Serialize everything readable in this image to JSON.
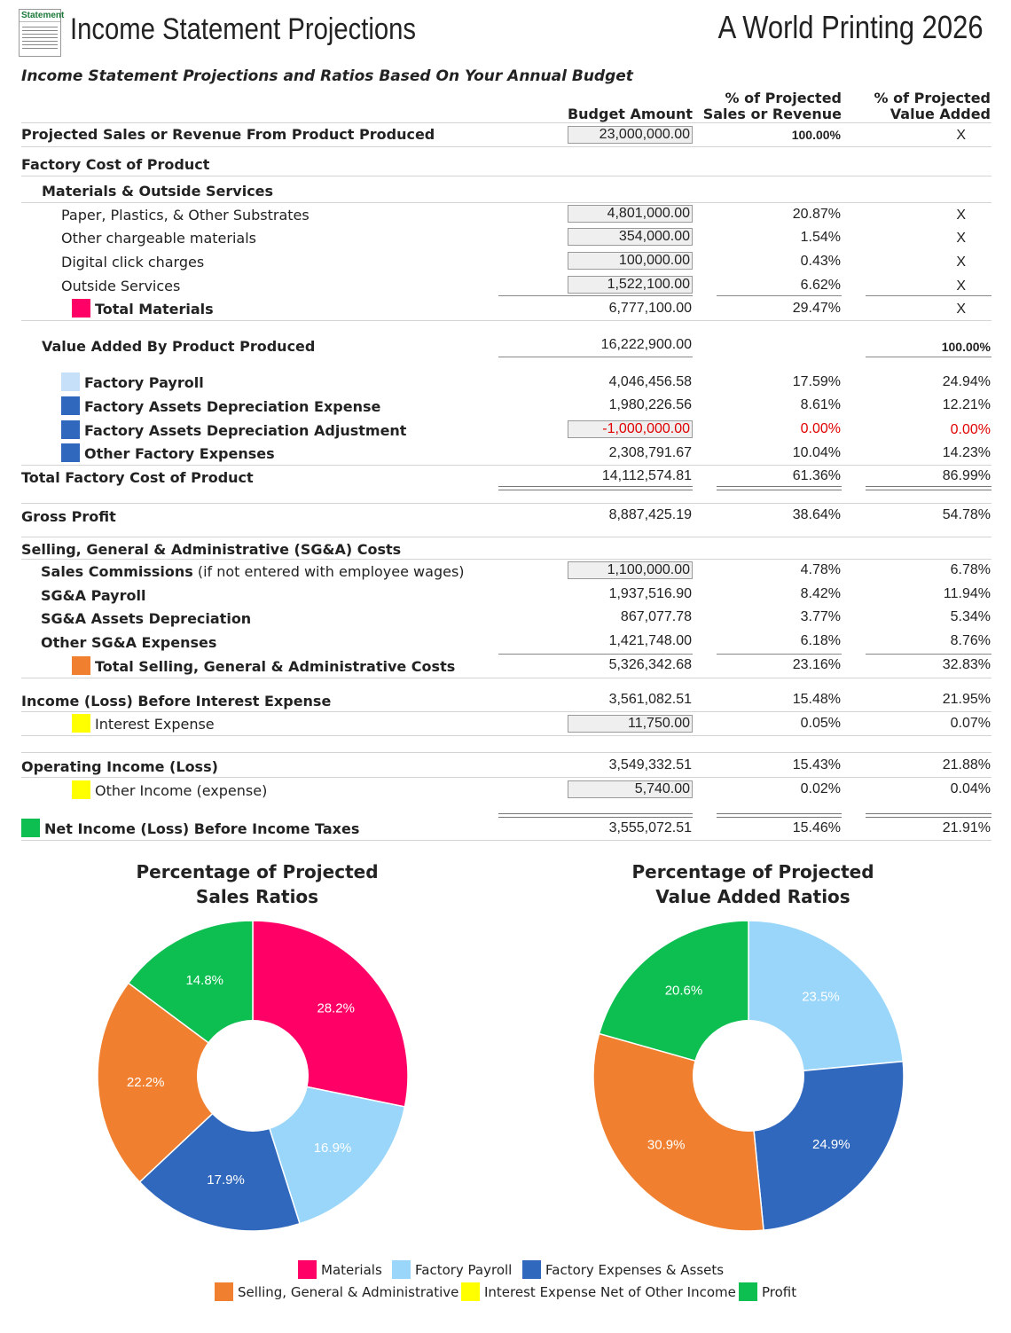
{
  "header": {
    "logo_text": "Statement",
    "title": "Income Statement Projections",
    "company": "A World Printing 2026",
    "subtitle": "Income Statement Projections and Ratios Based On Your Annual Budget"
  },
  "columns": {
    "budget": "Budget Amount",
    "sales_1": "% of Projected",
    "sales_2": "Sales or Revenue",
    "va_1": "% of Projected",
    "va_2": "Value Added"
  },
  "rows": {
    "sales": {
      "label": "Projected Sales or Revenue From Product Produced",
      "amount": "23,000,000.00",
      "pct_sales": "100.00%",
      "pct_va": "X"
    },
    "factory_cost": {
      "label": "Factory Cost of Product"
    },
    "materials_services": {
      "label": "Materials & Outside Services"
    },
    "paper": {
      "label": "Paper, Plastics, & Other Substrates",
      "amount": "4,801,000.00",
      "pct_sales": "20.87%",
      "pct_va": "X"
    },
    "other_materials": {
      "label": "Other chargeable materials",
      "amount": "354,000.00",
      "pct_sales": "1.54%",
      "pct_va": "X"
    },
    "digital": {
      "label": "Digital click charges",
      "amount": "100,000.00",
      "pct_sales": "0.43%",
      "pct_va": "X"
    },
    "outside": {
      "label": "Outside Services",
      "amount": "1,522,100.00",
      "pct_sales": "6.62%",
      "pct_va": "X"
    },
    "total_materials": {
      "label": "Total Materials",
      "amount": "6,777,100.00",
      "pct_sales": "29.47%",
      "pct_va": "X"
    },
    "value_added": {
      "label": "Value Added By Product Produced",
      "amount": "16,222,900.00",
      "pct_va": "100.00%"
    },
    "factory_payroll": {
      "label": "Factory Payroll",
      "amount": "4,046,456.58",
      "pct_sales": "17.59%",
      "pct_va": "24.94%"
    },
    "fa_dep": {
      "label": "Factory Assets Depreciation Expense",
      "amount": "1,980,226.56",
      "pct_sales": "8.61%",
      "pct_va": "12.21%"
    },
    "fa_adj": {
      "label": "Factory Assets Depreciation Adjustment",
      "amount": "-1,000,000.00",
      "pct_sales": "0.00%",
      "pct_va": "0.00%"
    },
    "other_factory": {
      "label": "Other Factory Expenses",
      "amount": "2,308,791.67",
      "pct_sales": "10.04%",
      "pct_va": "14.23%"
    },
    "total_factory": {
      "label": "Total Factory Cost of Product",
      "amount": "14,112,574.81",
      "pct_sales": "61.36%",
      "pct_va": "86.99%"
    },
    "gross_profit": {
      "label": "Gross Profit",
      "amount": "8,887,425.19",
      "pct_sales": "38.64%",
      "pct_va": "54.78%"
    },
    "sga_head": {
      "label": "Selling, General & Administrative (SG&A) Costs"
    },
    "commissions": {
      "label": "Sales Commissions",
      "note": "(if not entered with employee wages)",
      "amount": "1,100,000.00",
      "pct_sales": "4.78%",
      "pct_va": "6.78%"
    },
    "sga_payroll": {
      "label": "SG&A Payroll",
      "amount": "1,937,516.90",
      "pct_sales": "8.42%",
      "pct_va": "11.94%"
    },
    "sga_dep": {
      "label": "SG&A Assets Depreciation",
      "amount": "867,077.78",
      "pct_sales": "3.77%",
      "pct_va": "5.34%"
    },
    "other_sga": {
      "label": "Other SG&A Expenses",
      "amount": "1,421,748.00",
      "pct_sales": "6.18%",
      "pct_va": "8.76%"
    },
    "total_sga": {
      "label": "Total Selling, General & Administrative Costs",
      "amount": "5,326,342.68",
      "pct_sales": "23.16%",
      "pct_va": "32.83%"
    },
    "ebit": {
      "label": "Income (Loss) Before Interest Expense",
      "amount": "3,561,082.51",
      "pct_sales": "15.48%",
      "pct_va": "21.95%"
    },
    "interest": {
      "label": "Interest Expense",
      "amount": "11,750.00",
      "pct_sales": "0.05%",
      "pct_va": "0.07%"
    },
    "operating": {
      "label": "Operating Income (Loss)",
      "amount": "3,549,332.51",
      "pct_sales": "15.43%",
      "pct_va": "21.88%"
    },
    "other_income": {
      "label": "Other Income (expense)",
      "amount": "5,740.00",
      "pct_sales": "0.02%",
      "pct_va": "0.04%"
    },
    "net_income": {
      "label": "Net Income (Loss) Before Income Taxes",
      "amount": "3,555,072.51",
      "pct_sales": "15.46%",
      "pct_va": "21.91%"
    }
  },
  "colors": {
    "materials": "#ff0066",
    "factory_payroll_chip": "#c5e0f8",
    "factory_payroll": "#9ad6fa",
    "factory_expenses": "#3068bd",
    "sga": "#f08030",
    "interest": "#ffff00",
    "profit": "#0cbf50",
    "negative": "#e00000"
  },
  "chart_data": [
    {
      "type": "pie",
      "title_1": "Percentage of Projected",
      "title_2": "Sales Ratios",
      "categories": [
        "Materials",
        "Factory Payroll",
        "Factory Expenses & Assets",
        "Selling, General & Administrative",
        "Interest Expense Net of Other Income",
        "Profit"
      ],
      "values": [
        28.2,
        16.9,
        17.9,
        22.2,
        0.0,
        14.8
      ],
      "labels": [
        "28.2%",
        "16.9%",
        "17.9%",
        "22.2%",
        "",
        "14.8%"
      ],
      "donut": true
    },
    {
      "type": "pie",
      "title_1": "Percentage of Projected",
      "title_2": "Value Added Ratios",
      "categories": [
        "Factory Payroll",
        "Factory Expenses & Assets",
        "Selling, General & Administrative",
        "Interest Expense Net of Other Income",
        "Profit"
      ],
      "values": [
        23.5,
        24.9,
        30.9,
        0.0,
        20.6
      ],
      "labels": [
        "23.5%",
        "24.9%",
        "30.9%",
        "",
        "20.6%"
      ],
      "donut": true
    }
  ],
  "legend": [
    {
      "label": "Materials",
      "color": "#ff0066"
    },
    {
      "label": "Factory Payroll",
      "color": "#9ad6fa"
    },
    {
      "label": "Factory Expenses & Assets",
      "color": "#3068bd"
    },
    {
      "label": "Selling, General & Administrative",
      "color": "#f08030"
    },
    {
      "label": "Interest Expense Net of Other Income",
      "color": "#ffff00"
    },
    {
      "label": "Profit",
      "color": "#0cbf50"
    }
  ]
}
